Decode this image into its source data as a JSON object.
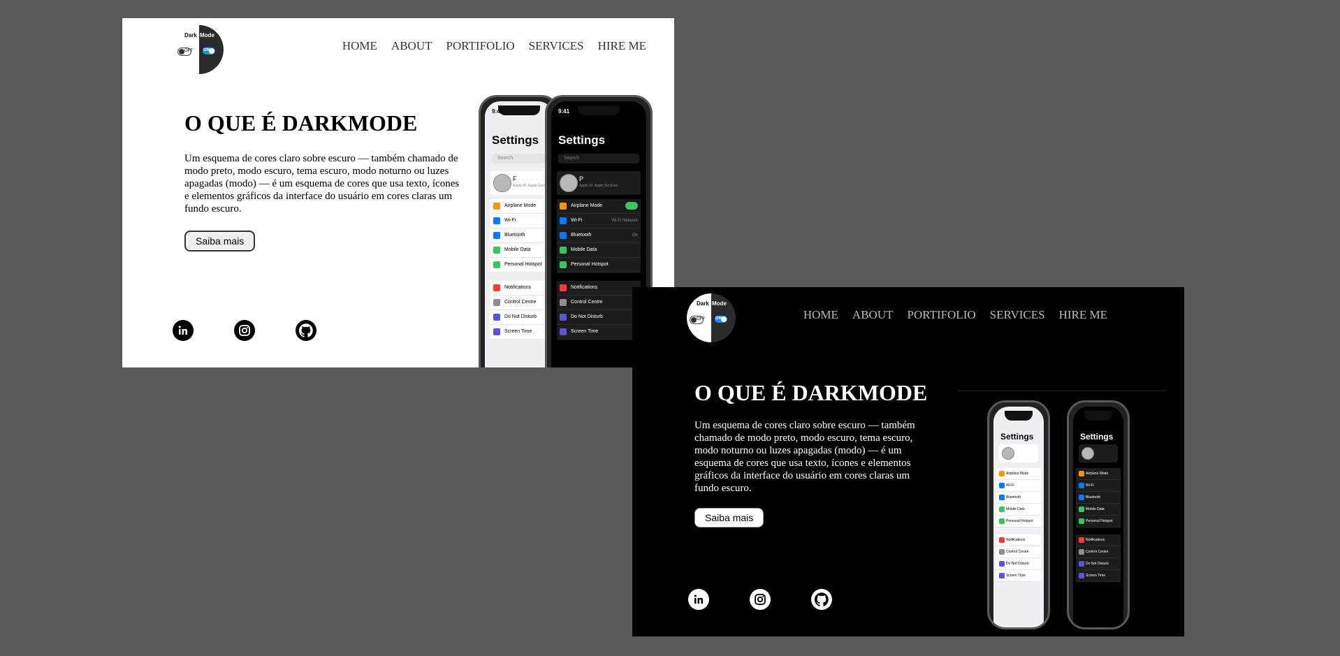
{
  "logo": {
    "text_left": "Dark",
    "text_right": "Mode",
    "toggle_off": "OFF",
    "toggle_on": "ON"
  },
  "nav": {
    "items": [
      "HOME",
      "ABOUT",
      "PORTIFOLIO",
      "SERVICES",
      "HIRE ME"
    ]
  },
  "hero": {
    "title": "O QUE É DARKMODE",
    "description": "Um esquema de cores claro sobre escuro — também chamado de modo preto, modo escuro, tema escuro, modo noturno ou luzes apagadas (modo) — é um esquema de cores que usa texto, ícones e elementos gráficos da interface do usuário em cores claras um fundo escuro.",
    "button": "Saiba mais"
  },
  "social": [
    "linkedin-icon",
    "instagram-icon",
    "github-icon"
  ],
  "colors": {
    "page_background": "#595959",
    "light_panel": "#ffffff",
    "dark_panel": "#000000",
    "toggle_on": "#1a8cff",
    "switch_green": "#34c759"
  },
  "phone_light": {
    "time": "9:41",
    "heading": "Settings",
    "search": "Search",
    "profile_name": "F",
    "profile_sub": "Apple ID, Apple Services",
    "rows": [
      {
        "label": "Airplane Mode",
        "color": "#ff9500",
        "value": ""
      },
      {
        "label": "Wi-Fi",
        "color": "#007aff",
        "value": ""
      },
      {
        "label": "Bluetooth",
        "color": "#007aff",
        "value": ""
      },
      {
        "label": "Mobile Data",
        "color": "#34c759",
        "value": ""
      },
      {
        "label": "Personal Hotspot",
        "color": "#34c759",
        "value": ""
      },
      {
        "label": "Notifications",
        "color": "#ff3b30",
        "value": ""
      },
      {
        "label": "Control Centre",
        "color": "#8e8e93",
        "value": ""
      },
      {
        "label": "Do Not Disturb",
        "color": "#5856d6",
        "value": ""
      },
      {
        "label": "Screen Time",
        "color": "#5856d6",
        "value": ""
      }
    ]
  },
  "phone_dark": {
    "time": "9:41",
    "heading": "Settings",
    "search": "Search",
    "profile_name": "P",
    "profile_sub": "Apple ID, Apple Services",
    "rows": [
      {
        "label": "Airplane Mode",
        "color": "#ff9500",
        "value": ""
      },
      {
        "label": "Wi-Fi",
        "color": "#007aff",
        "value": "Wi-Fi Network"
      },
      {
        "label": "Bluetooth",
        "color": "#007aff",
        "value": "On"
      },
      {
        "label": "Mobile Data",
        "color": "#34c759",
        "value": ""
      },
      {
        "label": "Personal Hotspot",
        "color": "#34c759",
        "value": ""
      },
      {
        "label": "Notifications",
        "color": "#ff3b30",
        "value": ""
      },
      {
        "label": "Control Centre",
        "color": "#8e8e93",
        "value": ""
      },
      {
        "label": "Do Not Disturb",
        "color": "#5856d6",
        "value": ""
      },
      {
        "label": "Screen Time",
        "color": "#5856d6",
        "value": ""
      }
    ]
  }
}
